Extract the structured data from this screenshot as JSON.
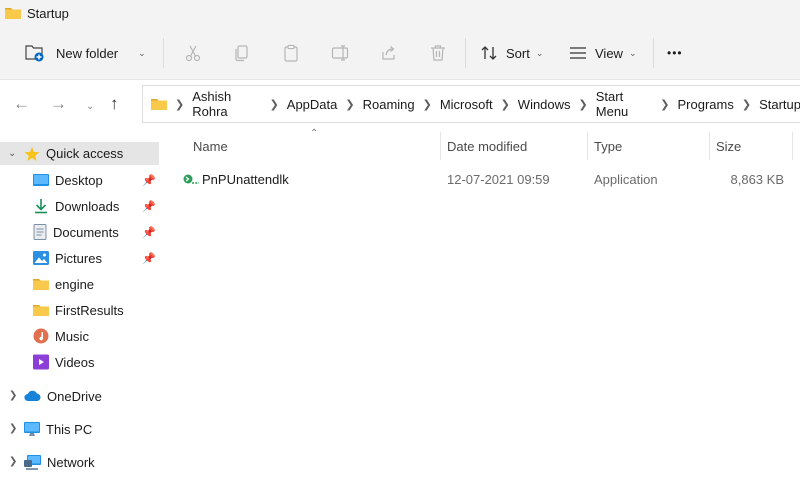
{
  "window": {
    "title": "Startup"
  },
  "toolbar": {
    "new_folder_label": "New folder",
    "sort_label": "Sort",
    "view_label": "View",
    "more_label": "•••",
    "icons": [
      "cut-icon",
      "copy-icon",
      "paste-icon",
      "rename-icon",
      "share-icon",
      "delete-icon"
    ]
  },
  "breadcrumb": [
    "Ashish Rohra",
    "AppData",
    "Roaming",
    "Microsoft",
    "Windows",
    "Start Menu",
    "Programs",
    "Startup"
  ],
  "sidebar": {
    "quick_access": "Quick access",
    "items": [
      {
        "label": "Desktop",
        "icon": "desktop-icon",
        "pinned": true
      },
      {
        "label": "Downloads",
        "icon": "downloads-icon",
        "pinned": true
      },
      {
        "label": "Documents",
        "icon": "documents-icon",
        "pinned": true
      },
      {
        "label": "Pictures",
        "icon": "pictures-icon",
        "pinned": true
      },
      {
        "label": "engine",
        "icon": "folder-icon",
        "pinned": false
      },
      {
        "label": "FirstResults",
        "icon": "folder-icon",
        "pinned": false
      },
      {
        "label": "Music",
        "icon": "music-icon",
        "pinned": false
      },
      {
        "label": "Videos",
        "icon": "videos-icon",
        "pinned": false
      }
    ],
    "onedrive": "OneDrive",
    "this_pc": "This PC",
    "network": "Network"
  },
  "columns": {
    "name": "Name",
    "date": "Date modified",
    "type": "Type",
    "size": "Size"
  },
  "files": [
    {
      "name": "PnPUnattendlk",
      "date": "12-07-2021 09:59",
      "type": "Application",
      "size": "8,863 KB"
    }
  ],
  "colors": {
    "folder": "#f8c94a",
    "accent": "#0067c0",
    "selected": "#e5e5e5"
  }
}
